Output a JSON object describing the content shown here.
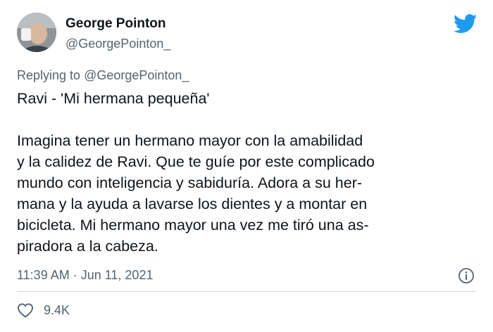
{
  "author": {
    "name": "George Pointon",
    "handle": "@GeorgePointon_"
  },
  "reply": {
    "prefix": "Replying to",
    "mention": "@GeorgePointon_"
  },
  "tweet": {
    "lines": [
      "Ravi - 'Mi hermana pequeña'",
      "",
      "Imagina tener un hermano mayor con la amabilidad",
      "y la calidez de Ravi. Que te guíe por este complicado",
      "mundo con inteligencia y sabiduría. Adora a su her-",
      "mana y la ayuda a lavarse los dientes y a montar en",
      "bicicleta. Mi hermano mayor una vez me tiró una as-",
      "piradora a la cabeza."
    ],
    "timestamp": "11:39 AM · Jun 11, 2021",
    "likes": "9.4K"
  },
  "icons": {
    "brand": "twitter-bird-icon",
    "info": "info-icon",
    "like": "heart-icon"
  },
  "colors": {
    "brand": "#1d9bf0",
    "secondary_text": "#536471",
    "primary_text": "#0f1419",
    "divider": "#cfd9de"
  }
}
